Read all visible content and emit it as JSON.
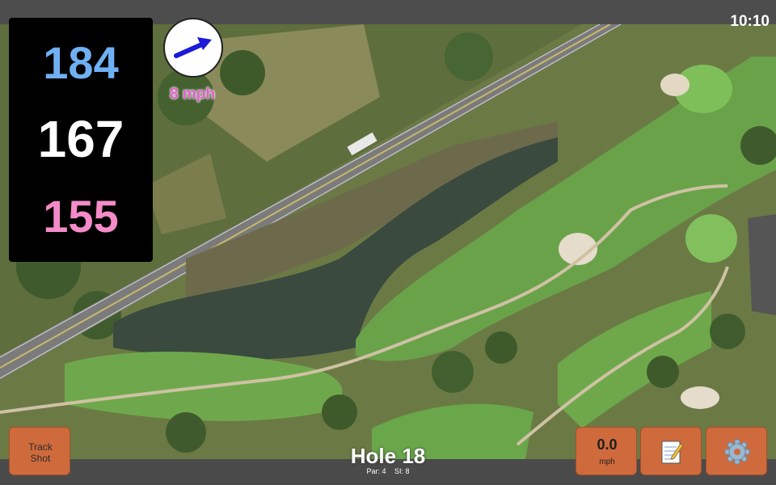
{
  "status": {
    "time": "10:10"
  },
  "distances": {
    "back": "184",
    "middle": "167",
    "front": "155"
  },
  "wind": {
    "speed_label": "8 mph",
    "arrow_icon": "arrow-right-icon"
  },
  "hole": {
    "title": "Hole 18",
    "par": "Par: 4",
    "si": "SI: 8"
  },
  "buttons": {
    "track_shot_line1": "Track",
    "track_shot_line2": "Shot",
    "speed_value": "0.0",
    "speed_unit": "mph",
    "notes_icon": "notepad-icon",
    "settings_icon": "gear-icon"
  },
  "colors": {
    "back_distance": "#6fb0f2",
    "middle_distance": "#ffffff",
    "front_distance": "#f48bc8",
    "wind_text": "#e060c8",
    "button": "#cf6a3c"
  }
}
